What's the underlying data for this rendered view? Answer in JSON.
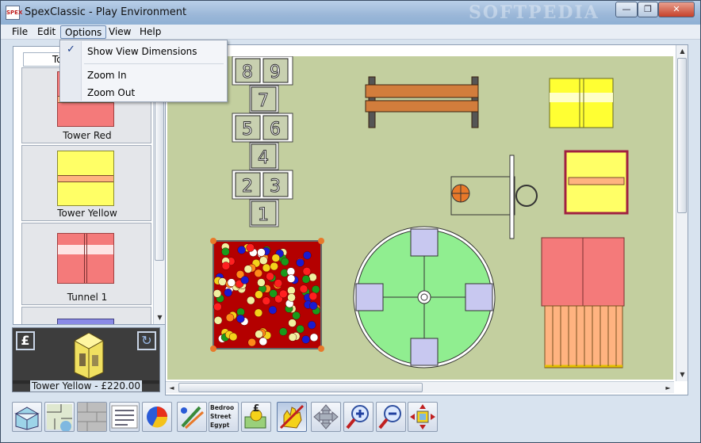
{
  "window": {
    "title": "SpexClassic - Play Environment",
    "app_icon_text": "SPEX",
    "watermark": "SOFTPEDIA",
    "minimize_glyph": "—",
    "restore_glyph": "❐",
    "close_glyph": "✕"
  },
  "menu": {
    "items": [
      "File",
      "Edit",
      "Options",
      "View",
      "Help"
    ],
    "open_item": "Options"
  },
  "options_menu": {
    "items": [
      {
        "label": "Show View Dimensions",
        "checked": true
      },
      {
        "label": "Zoom In",
        "checked": false
      },
      {
        "label": "Zoom Out",
        "checked": false
      }
    ],
    "check_glyph": "✓"
  },
  "library": {
    "search_value": "To",
    "items": [
      {
        "label": "Tower Red",
        "icon": "tower-red-thumbnail"
      },
      {
        "label": "Tower Yellow",
        "icon": "tower-yellow-thumbnail"
      },
      {
        "label": "Tunnel 1",
        "icon": "tunnel-thumbnail"
      }
    ],
    "scroll_up": "▲",
    "scroll_down": "▼"
  },
  "preview": {
    "pound_glyph": "£",
    "rotate_glyph": "↻",
    "caption": "Tower Yellow - £220.00"
  },
  "canvas": {
    "hopscotch_numbers": [
      "8",
      "9",
      "7",
      "5",
      "6",
      "4",
      "2",
      "3",
      "1"
    ],
    "scroll_left": "◄",
    "scroll_right": "►",
    "scroll_up": "▲",
    "scroll_down": "▼"
  },
  "toolbar": {
    "tools": [
      {
        "name": "3d-view-tool",
        "icon": "room-3d-icon"
      },
      {
        "name": "floor-plan-tool",
        "icon": "floor-plan-icon"
      },
      {
        "name": "surface-tool",
        "icon": "paving-icon"
      },
      {
        "name": "list-tool",
        "icon": "item-list-icon"
      },
      {
        "name": "chart-tool",
        "icon": "pie-chart-icon"
      },
      {
        "name": "paint-tool",
        "icon": "paint-brush-icon"
      },
      {
        "name": "address-tool",
        "icon": "address-label-icon"
      },
      {
        "name": "cost-tool",
        "icon": "money-icon"
      },
      {
        "name": "hand-tool",
        "icon": "hand-icon"
      },
      {
        "name": "move-tool",
        "icon": "move-arrows-icon"
      },
      {
        "name": "zoom-in-tool",
        "icon": "zoom-in-icon"
      },
      {
        "name": "zoom-out-tool",
        "icon": "zoom-out-icon"
      },
      {
        "name": "center-tool",
        "icon": "center-target-icon"
      }
    ],
    "address_lines": [
      "Bedroo",
      "Street",
      "Egypt"
    ],
    "money_glyph": "£"
  },
  "colors": {
    "canvas_bg": "#c3cf9f",
    "tower_red": "#f47a7a",
    "tower_yellow": "#ffff66",
    "stripe": "#ffb380",
    "roundabout": "#90ee90",
    "roundabout_seat": "#c8c8f0",
    "ball_pit": "#b40000",
    "bench": "#d27d3c"
  }
}
